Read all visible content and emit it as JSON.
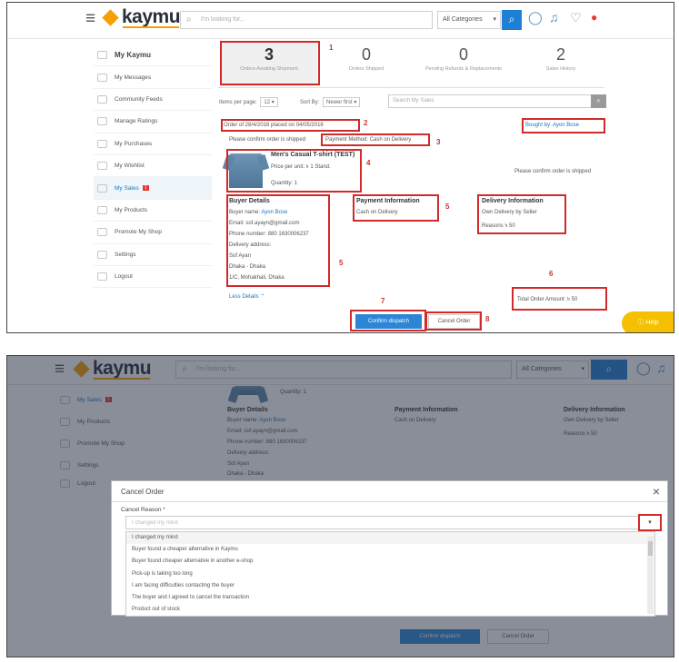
{
  "header": {
    "brand": "kaymu",
    "search_placeholder": "I'm looking for...",
    "category": "All Categories"
  },
  "sidebar": {
    "items": [
      {
        "label": "My Kaymu"
      },
      {
        "label": "My Messages"
      },
      {
        "label": "Community Feeds"
      },
      {
        "label": "Manage Ratings"
      },
      {
        "label": "My Purchases"
      },
      {
        "label": "My Wishlist"
      },
      {
        "label": "My Sales",
        "badge": "1"
      },
      {
        "label": "My Products"
      },
      {
        "label": "Promote My Shop"
      },
      {
        "label": "Settings"
      },
      {
        "label": "Logout"
      }
    ]
  },
  "tabs": [
    {
      "count": "3",
      "label": "Orders Awaiting Shipment"
    },
    {
      "count": "0",
      "label": "Orders Shipped"
    },
    {
      "count": "0",
      "label": "Pending Refunds & Replacements"
    },
    {
      "count": "2",
      "label": "Sales History"
    }
  ],
  "filters": {
    "items_per_page_label": "Items per page:",
    "items_per_page": "12",
    "sort_label": "Sort By:",
    "sort_value": "Newer first",
    "search_placeholder": "Search My Sales"
  },
  "order": {
    "header": "Order of 28/4/2016 placed on 04/05/2016",
    "confirm_note": "Please confirm order is shipped",
    "payment_method": "Payment Method: Cash on Delivery",
    "bought_by": "Bought by: Ayon Bose",
    "product_name": "Men's Casual T-shirt (TEST)",
    "price_per_unit": "Price per unit: ৳ 1 Stand.",
    "quantity": "Quantity: 1",
    "status_note": "Please confirm order is shipped",
    "buyer_title": "Buyer Details",
    "buyer_name_label": "Buyer name:",
    "buyer_name": "Ayon Bose",
    "email": "Email: sof.ayayn@gmail.com",
    "phone": "Phone number: 880 1630006237",
    "delivery_label": "Delivery address:",
    "addr1": "Sof Ayan",
    "addr2": "Dhaka - Dhaka",
    "addr3": "1/C, Mohakhali, Dhaka",
    "less_details": "Less Details",
    "payment_title": "Payment Information",
    "payment_value": "Cash on Delivery",
    "delivery_title": "Delivery Information",
    "delivery_value": "Own Delivery by Seller",
    "delivery_fee": "Reasons ৳ 50",
    "total": "Total Order Amount: ৳ 50",
    "confirm_btn": "Confirm dispatch",
    "cancel_btn": "Cancel Order",
    "help": "Help"
  },
  "annotations": [
    "1",
    "2",
    "3",
    "4",
    "5",
    "5",
    "6",
    "7",
    "8"
  ],
  "modal": {
    "title": "Cancel Order",
    "close": "×",
    "reason_label": "Cancel Reason",
    "required": "*",
    "placeholder": "I changed my mind",
    "options": [
      "I changed my mind",
      "Buyer found a cheaper alternative in Kaymu",
      "Buyer found cheaper alternative in another e-shop",
      "Pick-up is taking too long",
      "I am facing difficulties contacting the buyer",
      "The buyer and I agreed to cancel the transaction",
      "Product out of stock"
    ]
  }
}
